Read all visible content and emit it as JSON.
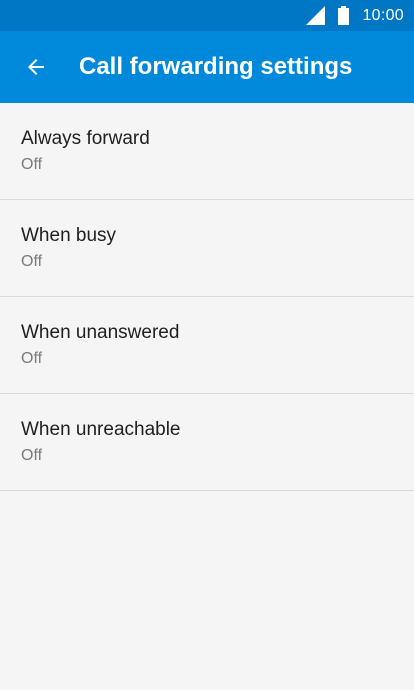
{
  "status_bar": {
    "time": "10:00",
    "icons": [
      "signal-icon",
      "battery-icon"
    ]
  },
  "app_bar": {
    "back_icon": "arrow-left-icon",
    "title": "Call forwarding settings"
  },
  "settings": [
    {
      "title": "Always forward",
      "status": "Off"
    },
    {
      "title": "When busy",
      "status": "Off"
    },
    {
      "title": "When unanswered",
      "status": "Off"
    },
    {
      "title": "When unreachable",
      "status": "Off"
    }
  ],
  "colors": {
    "status_bar": "#0077c4",
    "app_bar": "#0088db",
    "background": "#f5f5f5",
    "divider": "#d9d9d9",
    "primary_text": "#202020",
    "secondary_text": "#7a7a7a"
  }
}
